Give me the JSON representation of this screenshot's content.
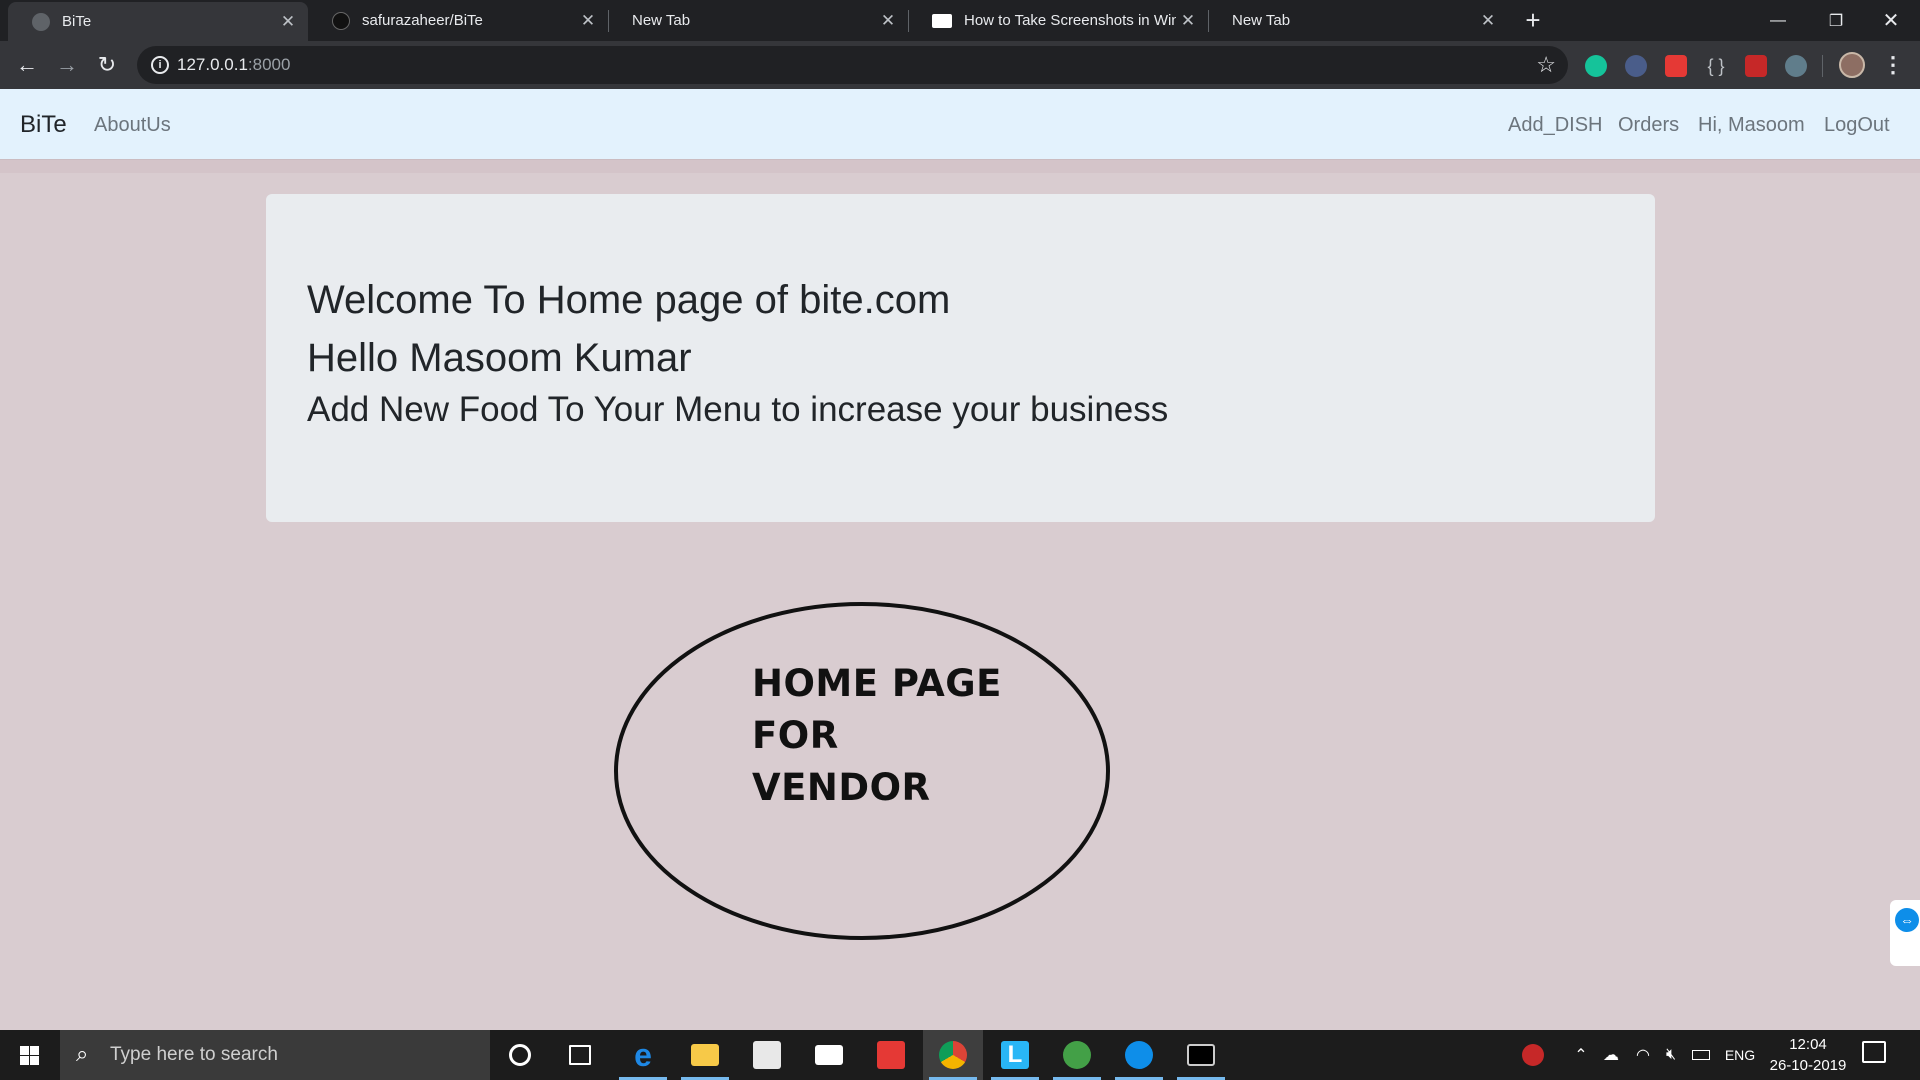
{
  "browser": {
    "tabs": [
      {
        "title": "BiTe",
        "active": true
      },
      {
        "title": "safurazaheer/BiTe",
        "active": false
      },
      {
        "title": "New Tab",
        "active": false
      },
      {
        "title": "How to Take Screenshots in Wind",
        "active": false
      },
      {
        "title": "New Tab",
        "active": false
      }
    ],
    "url_host": "127.0.0.1",
    "url_port": ":8000"
  },
  "navbar": {
    "brand": "BiTe",
    "left_links": [
      "AboutUs"
    ],
    "right_links": [
      "Add_DISH",
      "Orders",
      "Hi, Masoom",
      "LogOut"
    ],
    "background": "#e3f2fd"
  },
  "jumbotron": {
    "line1": "Welcome To Home page of bite.com",
    "line2": "Hello Masoom Kumar",
    "line3": "Add New Food To Your Menu to increase your business"
  },
  "ellipse_text": {
    "line1": "HOME PAGE",
    "line2": "FOR",
    "line3": "VENDOR"
  },
  "taskbar": {
    "search_placeholder": "Type here to search",
    "language": "ENG",
    "time": "12:04",
    "date": "26-10-2019"
  },
  "colors": {
    "page_background": "#d9ccd0",
    "jumbotron": "#e9ecef",
    "chrome_dark": "#202124",
    "chrome_toolbar": "#35363a"
  }
}
